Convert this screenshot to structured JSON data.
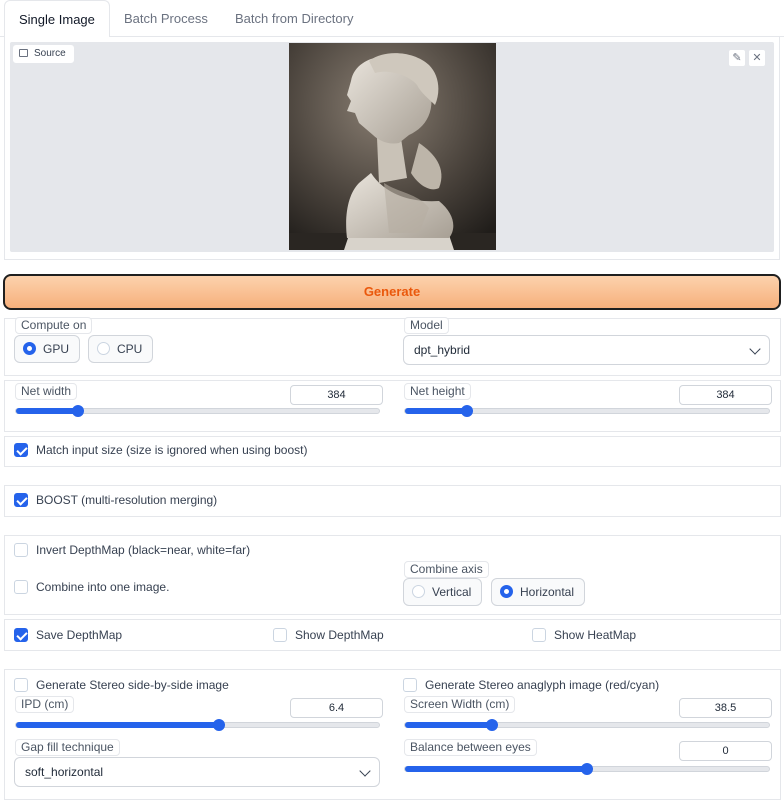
{
  "tabs": [
    "Single Image",
    "Batch Process",
    "Batch from Directory"
  ],
  "source": {
    "label": "Source",
    "edit_icon": "pencil-icon",
    "close_icon": "close-icon"
  },
  "generate_label": "Generate",
  "compute": {
    "label": "Compute on",
    "options": [
      "GPU",
      "CPU"
    ],
    "selected": "GPU"
  },
  "model": {
    "label": "Model",
    "value": "dpt_hybrid"
  },
  "net_width": {
    "label": "Net width",
    "value": "384",
    "fraction": 0.17
  },
  "net_height": {
    "label": "Net height",
    "value": "384",
    "fraction": 0.17
  },
  "match_input": {
    "label": "Match input size (size is ignored when using boost)",
    "checked": true
  },
  "boost": {
    "label": "BOOST (multi-resolution merging)",
    "checked": true
  },
  "invert": {
    "label": "Invert DepthMap (black=near, white=far)",
    "checked": false
  },
  "combine": {
    "label": "Combine into one image.",
    "checked": false
  },
  "combine_axis": {
    "label": "Combine axis",
    "options": [
      "Vertical",
      "Horizontal"
    ],
    "selected": "Horizontal"
  },
  "save_depthmap": {
    "label": "Save DepthMap",
    "checked": true
  },
  "show_depthmap": {
    "label": "Show DepthMap",
    "checked": false
  },
  "show_heatmap": {
    "label": "Show HeatMap",
    "checked": false
  },
  "stereo_sbs": {
    "label": "Generate Stereo side-by-side image",
    "checked": false
  },
  "stereo_anaglyph": {
    "label": "Generate Stereo anaglyph image (red/cyan)",
    "checked": false
  },
  "ipd": {
    "label": "IPD (cm)",
    "value": "6.4",
    "fraction": 0.56
  },
  "screen_width": {
    "label": "Screen Width (cm)",
    "value": "38.5",
    "fraction": 0.24
  },
  "gap_fill": {
    "label": "Gap fill technique",
    "value": "soft_horizontal"
  },
  "balance": {
    "label": "Balance between eyes",
    "value": "0",
    "fraction": 0.5
  },
  "colors": {
    "accent": "#2563eb",
    "generate_text": "#ea580c",
    "generate_bg": "#f9bf8f"
  }
}
